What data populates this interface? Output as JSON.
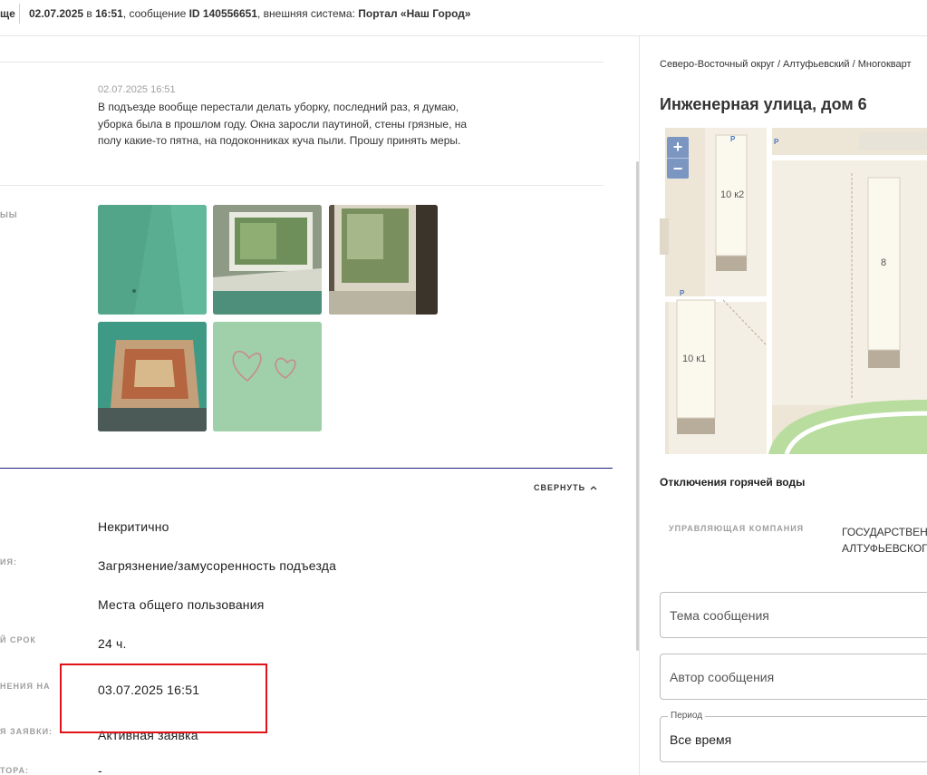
{
  "header": {
    "tail": "ще",
    "date": "02.07.2025",
    "in": " в ",
    "time": "16:51",
    "msg_prefix": ", сообщение ",
    "msg_id": "ID 140556651",
    "system_prefix": ", внешняя система: ",
    "system": "Портал «Наш Город»"
  },
  "message": {
    "date": "02.07.2025 16:51",
    "text": "В подъезде вообще перестали делать уборку, последний раз, я думаю, уборка была в прошлом году. Окна заросли паутиной, стены грязные, на полу какие-то пятна, на подоконниках куча пыли. Прошу принять меры."
  },
  "photos_label_cut": "ЫЫ",
  "photos": [
    "photo-1",
    "photo-2",
    "photo-3",
    "photo-4",
    "photo-5"
  ],
  "details": {
    "collapse_label": "СВЕРНУТЬ",
    "rows": [
      {
        "label": "",
        "value": "Некритично"
      },
      {
        "label": "ИЯ:",
        "value": "Загрязнение/замусоренность подъезда"
      },
      {
        "label": "",
        "value": "Места общего пользования"
      },
      {
        "label": "Й СРОК",
        "value": "24 ч."
      },
      {
        "label": "НЕНИЯ НА",
        "value": "03.07.2025 16:51"
      },
      {
        "label": "Я ЗАЯВКИ:",
        "value": "Активная заявка"
      },
      {
        "label": "ТОРА:",
        "value": "-"
      }
    ]
  },
  "right": {
    "breadcrumbs": "Северо-Восточный округ / Алтуфьевский / Многокварт",
    "address": "Инженерная улица, дом 6",
    "map": {
      "zoom_in": "+",
      "zoom_out": "−",
      "buildings": [
        "10 к2",
        "8",
        "10 к1"
      ],
      "parking": "P"
    },
    "hot_water": "Отключения горячей воды",
    "management_label": "УПРАВЛЯЮЩАЯ КОМПАНИЯ",
    "management_value_1": "ГОСУДАРСТВЕН",
    "management_value_2": "АЛТУФЬЕВСКОГ",
    "topic_placeholder": "Тема сообщения",
    "author_placeholder": "Автор сообщения",
    "period_label": "Период",
    "period_value": "Все время"
  },
  "colors": {
    "accent_line": "#1a237e",
    "highlight": "#e0131b",
    "zoom_control": "#7c96c2"
  }
}
